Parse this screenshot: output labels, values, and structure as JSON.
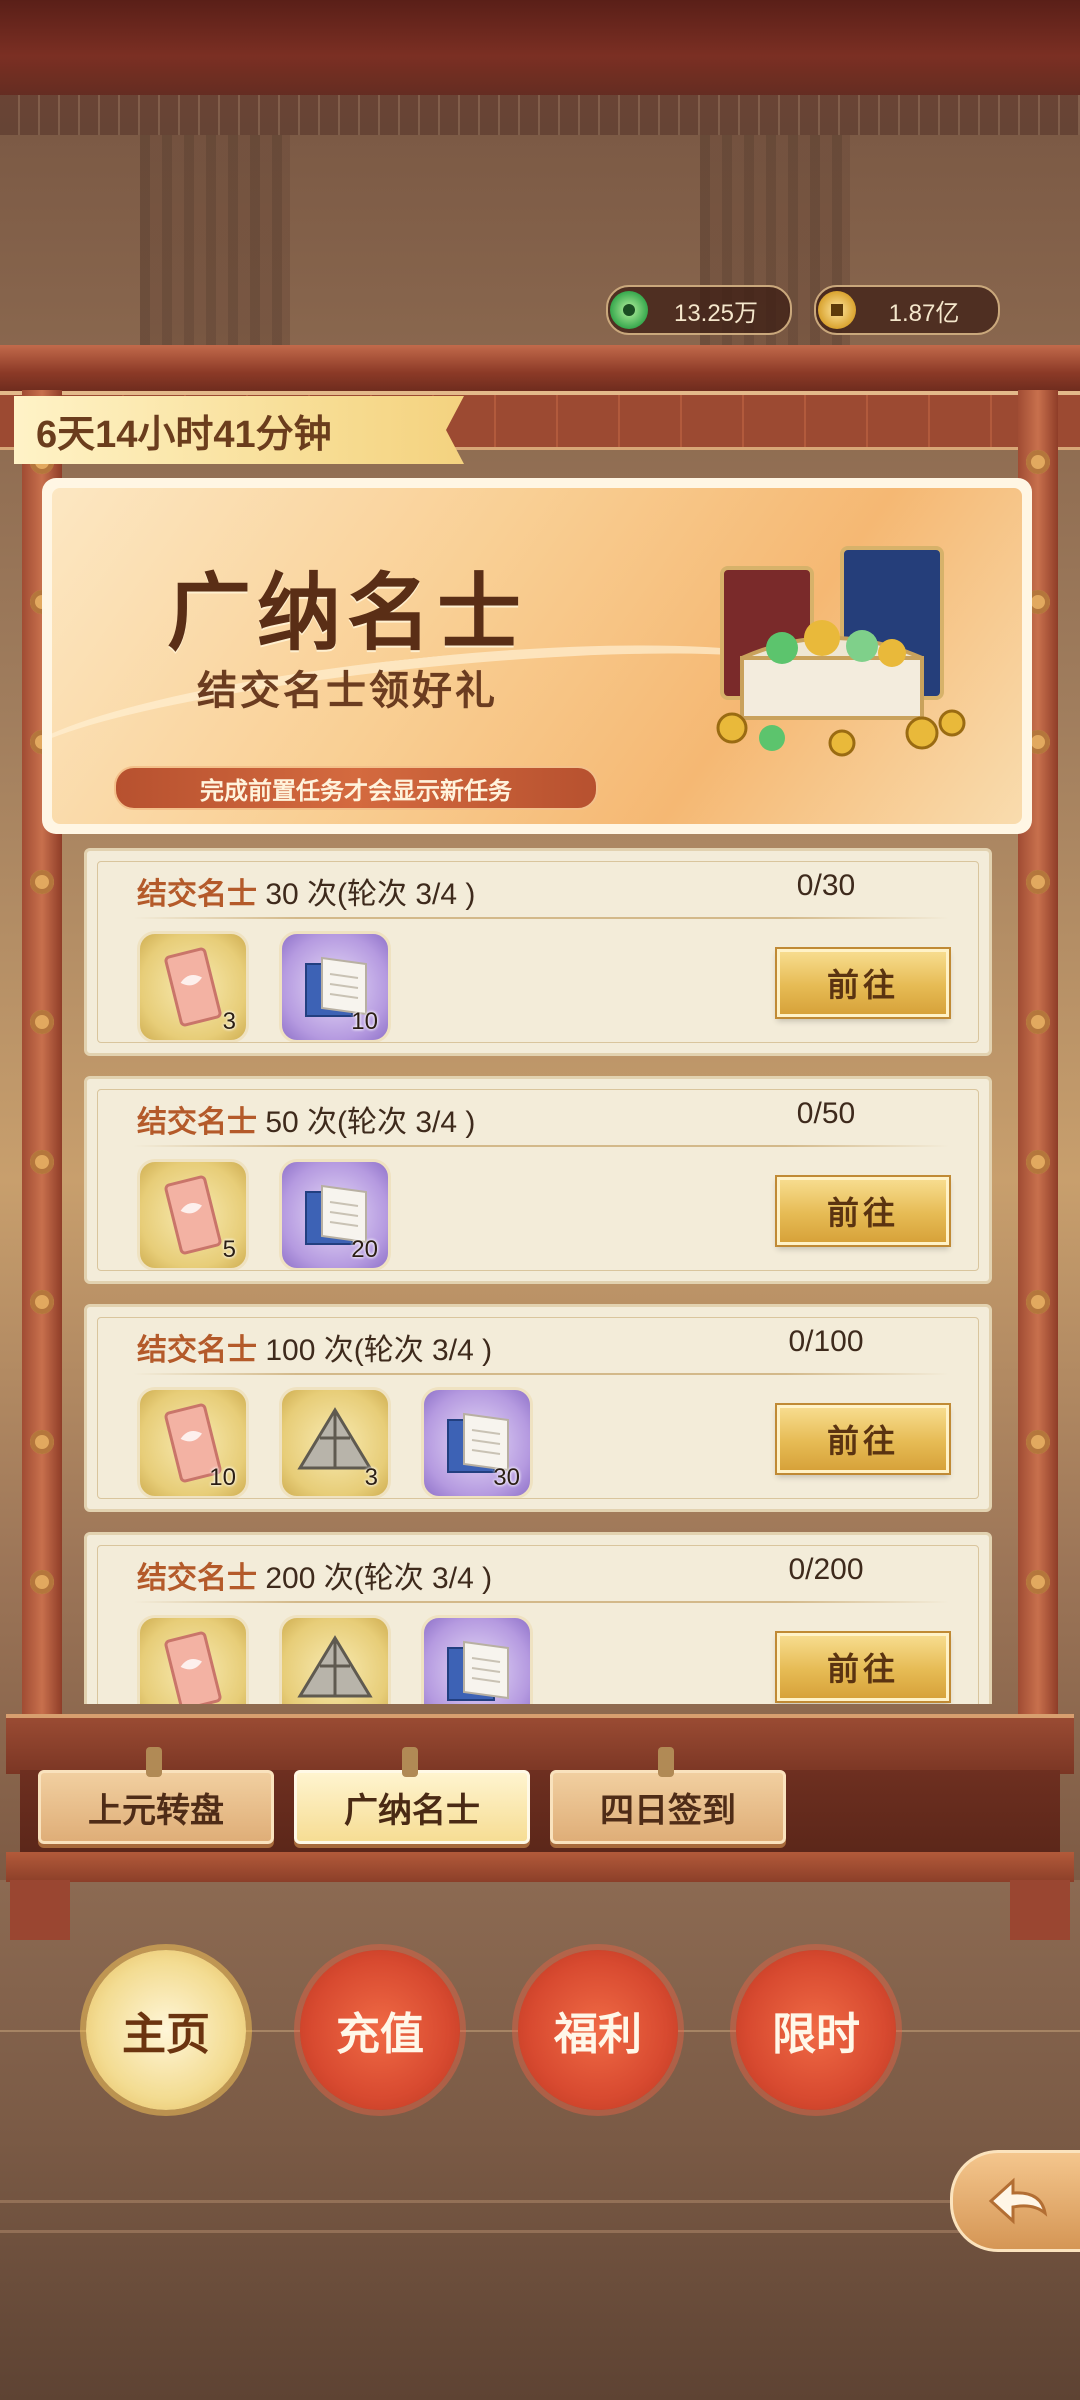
{
  "currency": {
    "jade": "13.25万",
    "gold": "1.87亿"
  },
  "timer": "6天14小时41分钟",
  "banner": {
    "title": "广纳名士",
    "subtitle": "结交名士领好礼",
    "note": "完成前置任务才会显示新任务"
  },
  "tasks": [
    {
      "keyword": "结交名士",
      "count_text": "30 次(轮次 3/4 )",
      "progress": "0/30",
      "button": "前往",
      "rewards": [
        {
          "icon": "pink-token-icon",
          "qty": "3"
        },
        {
          "icon": "book-icon",
          "qty": "10"
        }
      ]
    },
    {
      "keyword": "结交名士",
      "count_text": "50 次(轮次 3/4 )",
      "progress": "0/50",
      "button": "前往",
      "rewards": [
        {
          "icon": "pink-token-icon",
          "qty": "5"
        },
        {
          "icon": "book-icon",
          "qty": "20"
        }
      ]
    },
    {
      "keyword": "结交名士",
      "count_text": "100 次(轮次 3/4 )",
      "progress": "0/100",
      "button": "前往",
      "rewards": [
        {
          "icon": "pink-token-icon",
          "qty": "10"
        },
        {
          "icon": "tent-icon",
          "qty": "3"
        },
        {
          "icon": "book-icon",
          "qty": "30"
        }
      ]
    },
    {
      "keyword": "结交名士",
      "count_text": "200 次(轮次 3/4 )",
      "progress": "0/200",
      "button": "前往",
      "rewards": [
        {
          "icon": "pink-token-icon",
          "qty": ""
        },
        {
          "icon": "tent-icon",
          "qty": ""
        },
        {
          "icon": "book-icon",
          "qty": ""
        }
      ]
    }
  ],
  "tabs": [
    "上元转盘",
    "广纳名士",
    "四日签到"
  ],
  "active_tab": "广纳名士",
  "nav": [
    "主页",
    "充值",
    "福利",
    "限时"
  ],
  "colors": {
    "accent_red": "#d84a30",
    "gold_button": "#e6bb54",
    "keyword": "#b45a2a"
  }
}
